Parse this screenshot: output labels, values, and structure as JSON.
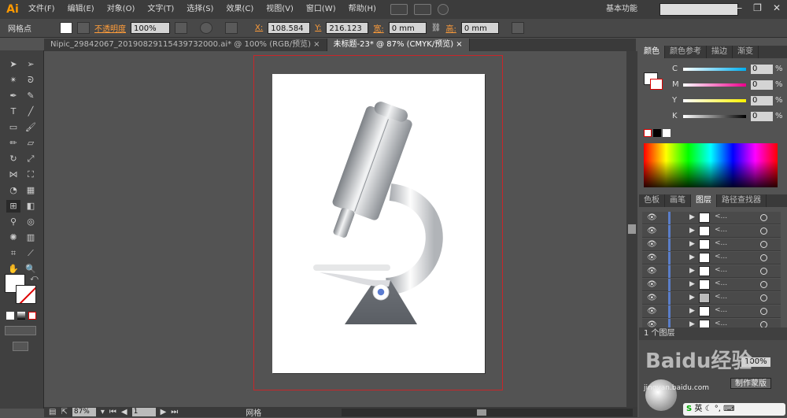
{
  "app": {
    "logo": "Ai"
  },
  "menu": [
    "文件(F)",
    "编辑(E)",
    "对象(O)",
    "文字(T)",
    "选择(S)",
    "效果(C)",
    "视图(V)",
    "窗口(W)",
    "帮助(H)"
  ],
  "workspace": "基本功能",
  "control": {
    "selection": "网格点",
    "opacity_label": "不透明度",
    "opacity_value": "100%",
    "x_label": "X:",
    "x_value": "108.584",
    "y_label": "Y:",
    "y_value": "216.123",
    "w_label": "宽:",
    "w_value": "0 mm",
    "h_label": "高:",
    "h_value": "0 mm"
  },
  "doc_tabs": [
    {
      "label": "Nipic_29842067_20190829115439732000.ai* @ 100% (RGB/预览)",
      "close": "×"
    },
    {
      "label": "未标题-23* @ 87% (CMYK/预览)",
      "close": "×"
    }
  ],
  "color_panel": {
    "tabs": [
      "颜色",
      "颜色参考",
      "描边",
      "渐变"
    ],
    "channels": [
      {
        "name": "C",
        "value": "0",
        "unit": "%"
      },
      {
        "name": "M",
        "value": "0",
        "unit": "%"
      },
      {
        "name": "Y",
        "value": "0",
        "unit": "%"
      },
      {
        "name": "K",
        "value": "0",
        "unit": "%"
      }
    ]
  },
  "layers_panel": {
    "tabs": [
      "色板",
      "画笔",
      "图层",
      "路径查找器"
    ],
    "rows": [
      "<...",
      "<...",
      "<...",
      "<...",
      "<...",
      "<...",
      "<...",
      "<...",
      "<...",
      "<..."
    ],
    "footer": "1 个图层"
  },
  "transparency": {
    "opacity": "100%",
    "mask_button": "制作蒙版"
  },
  "status": {
    "zoom": "87%",
    "page": "1",
    "tool": "网格"
  },
  "watermark": {
    "text": "Baidu经验",
    "url": "jingyan.baidu.com",
    "ime": "英"
  }
}
